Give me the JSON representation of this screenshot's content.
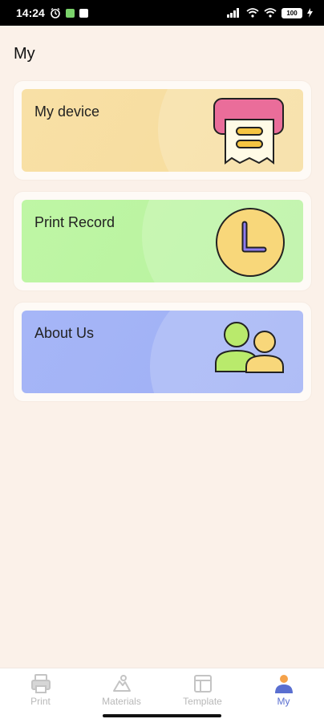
{
  "status_bar": {
    "time": "14:24",
    "battery_level": "100"
  },
  "page": {
    "title": "My"
  },
  "cards": [
    {
      "label": "My device",
      "icon": "printer-receipt-icon",
      "color": "#f7dfa0"
    },
    {
      "label": "Print Record",
      "icon": "clock-icon",
      "color": "#bdf5a3"
    },
    {
      "label": "About Us",
      "icon": "users-icon",
      "color": "#a3b4f5"
    }
  ],
  "bottom_nav": {
    "items": [
      {
        "label": "Print",
        "icon": "printer-icon",
        "active": false
      },
      {
        "label": "Materials",
        "icon": "materials-icon",
        "active": false
      },
      {
        "label": "Template",
        "icon": "template-icon",
        "active": false
      },
      {
        "label": "My",
        "icon": "person-icon",
        "active": true
      }
    ],
    "active_color": "#5a6fd0"
  }
}
